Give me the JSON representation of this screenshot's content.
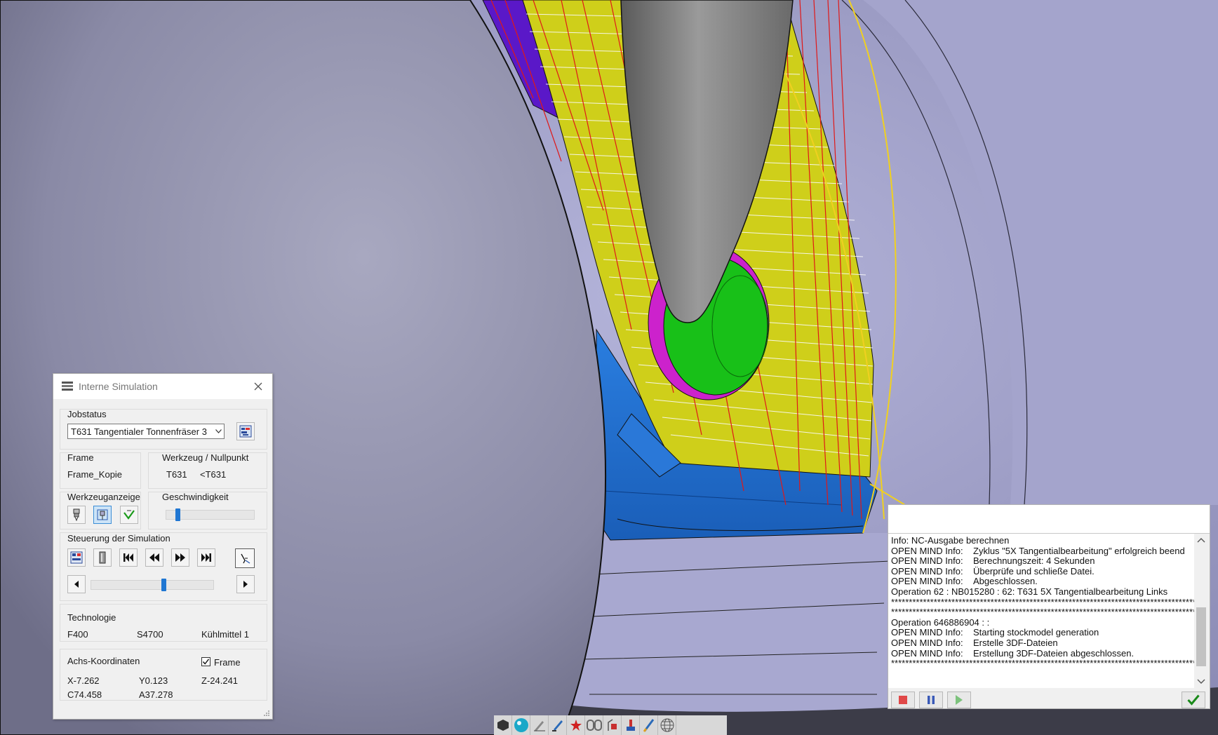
{
  "panel": {
    "title": "Interne Simulation",
    "jobstatus_label": "Jobstatus",
    "job_selected": "T631 Tangentialer Tonnenfräser 3",
    "frame_label": "Frame",
    "frame_value": "Frame_Kopie",
    "tool_label": "Werkzeug / Nullpunkt",
    "tool_value": "T631",
    "zero_value": "<T631",
    "tool_display_label": "Werkzeuganzeige",
    "speed_label": "Geschwindigkeit",
    "speed_level": 0.12,
    "control_label": "Steuerung der Simulation",
    "progress_level": 0.6,
    "tech_label": "Technologie",
    "feed": "F400",
    "spindle": "S4700",
    "coolant": "Kühlmittel  1",
    "axis_label": "Achs-Koordinaten",
    "frame_checkbox_label": "Frame",
    "frame_checked": true,
    "x": "X-7.262",
    "y": "Y0.123",
    "z": "Z-24.241",
    "c": "C74.458",
    "a": "A37.278"
  },
  "log": {
    "lines": [
      {
        "prefix": "Info: NC-Ausgabe berechnen",
        "text": ""
      },
      {
        "prefix": "OPEN MIND Info:",
        "text": "Zyklus \"5X Tangentialbearbeitung\" erfolgreich beend"
      },
      {
        "prefix": "OPEN MIND Info:",
        "text": "Berechnungszeit: 4 Sekunden"
      },
      {
        "prefix": "OPEN MIND Info:",
        "text": "Überprüfe und schließe Datei."
      },
      {
        "prefix": "OPEN MIND Info:",
        "text": "Abgeschlossen."
      },
      {
        "prefix": "Operation 62 : NB015280 :  62: T631 5X Tangentialbearbeitung Links",
        "text": ""
      },
      {
        "prefix": "****************************************************************************************",
        "text": ""
      },
      {
        "prefix": "****************************************************************************************",
        "text": ""
      },
      {
        "prefix": "Operation 646886904 :  :",
        "text": ""
      },
      {
        "prefix": "OPEN MIND Info:",
        "text": "Starting stockmodel generation"
      },
      {
        "prefix": "OPEN MIND Info:",
        "text": "Erstelle 3DF-Dateien"
      },
      {
        "prefix": "OPEN MIND Info:",
        "text": "Erstellung 3DF-Dateien abgeschlossen."
      },
      {
        "prefix": "****************************************************************************************",
        "text": ""
      }
    ]
  },
  "colors": {
    "viewport_bg": "#9a9ac2",
    "yellow_surface": "#cfcf1a",
    "blue_surface": "#1f6ed2",
    "green_hole": "#18c018",
    "magenta": "#cc22cc",
    "tool_grey": "#8a8a8a",
    "accent_blue": "#1f76d2"
  }
}
